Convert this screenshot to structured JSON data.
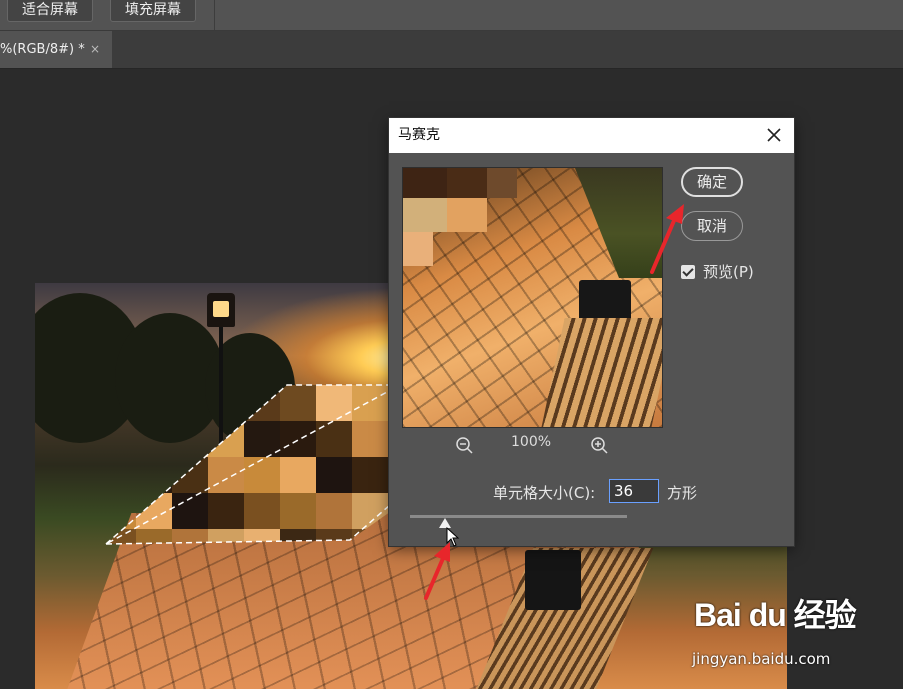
{
  "toolbar": {
    "fit_screen": "适合屏幕",
    "fill_screen": "填充屏幕"
  },
  "document_tab": {
    "title": "%(RGB/8#) *",
    "close": "×"
  },
  "dialog": {
    "title": "马赛克",
    "ok": "确定",
    "cancel": "取消",
    "preview_label": "预览(P)",
    "preview_checked": true,
    "zoom_level": "100%",
    "cell_size_label": "单元格大小(C):",
    "cell_size_value": "36",
    "cell_unit": "方形",
    "slider_value": 36
  },
  "watermark": {
    "logo": "Bai du 经验",
    "url": "jingyan.baidu.com"
  },
  "colors": {
    "app_bg": "#2b2b2b",
    "panel": "#535353",
    "accent_arrow": "#e8262b",
    "input_focus": "#6aa0ff"
  }
}
